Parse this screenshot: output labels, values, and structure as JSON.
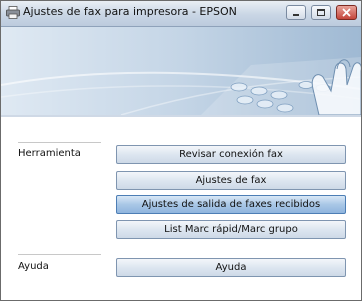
{
  "window": {
    "title": "Ajustes de fax para impresora - EPSON"
  },
  "sections": [
    {
      "label": "Herramienta",
      "buttons": [
        {
          "label": "Revisar conexión fax"
        },
        {
          "label": "Ajustes de fax"
        },
        {
          "label": "Ajustes de salida de faxes recibidos"
        },
        {
          "label": "List Marc rápid/Marc grupo"
        }
      ]
    },
    {
      "label": "Ayuda",
      "buttons": [
        {
          "label": "Ayuda"
        }
      ]
    }
  ],
  "colors": {
    "banner": "#c3d4e4",
    "accent": "#4d7eb5"
  }
}
